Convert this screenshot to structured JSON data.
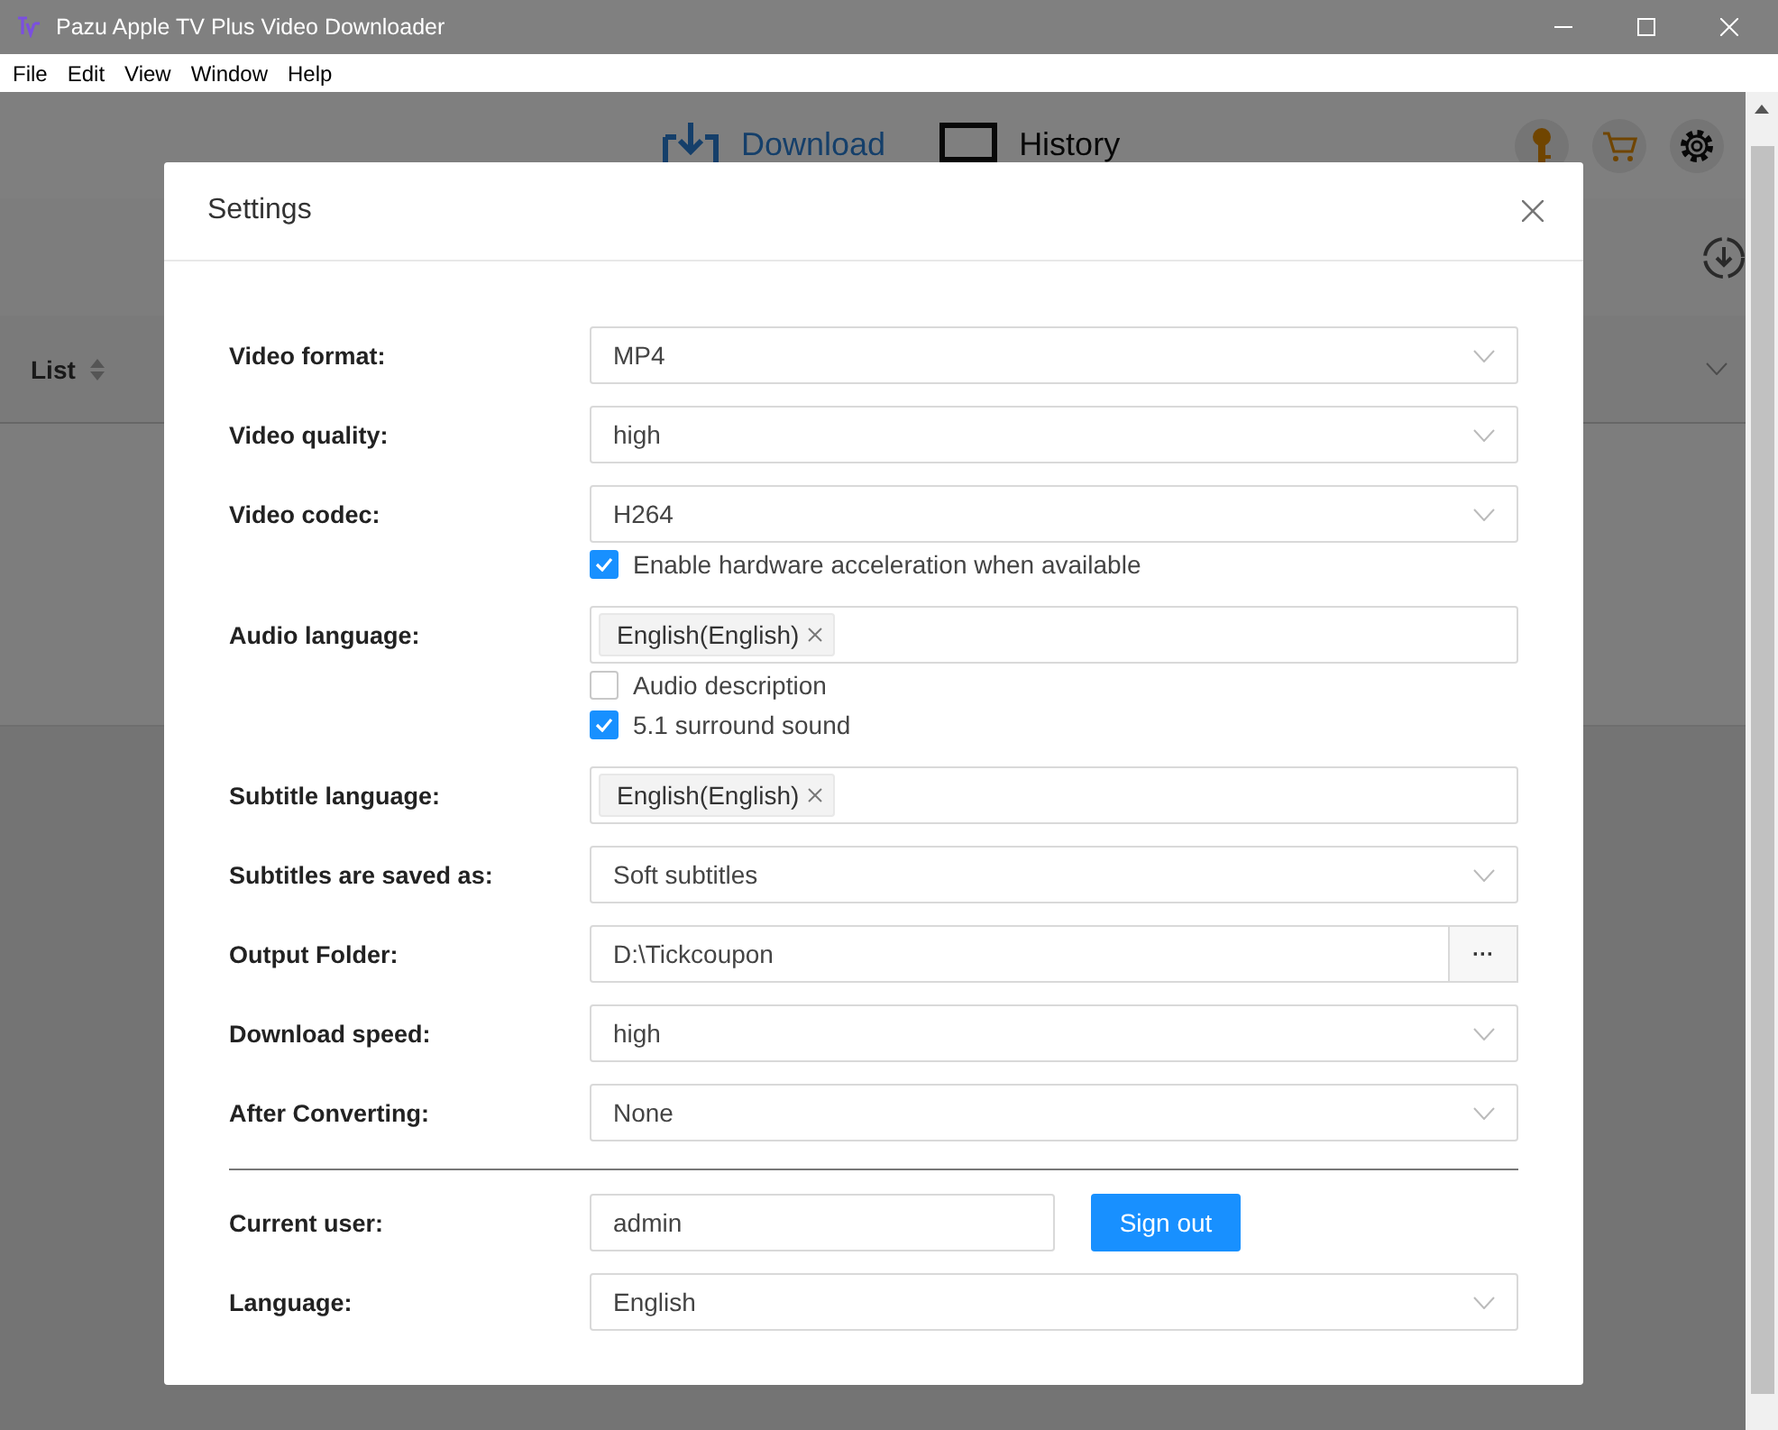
{
  "window": {
    "title": "Pazu Apple TV Plus Video Downloader"
  },
  "menu": [
    "File",
    "Edit",
    "View",
    "Window",
    "Help"
  ],
  "toolbar": {
    "tabs": [
      {
        "label": "Download",
        "selected": true
      },
      {
        "label": "History",
        "selected": false
      }
    ]
  },
  "list_header": {
    "label": "List"
  },
  "dialog": {
    "title": "Settings",
    "fields": [
      {
        "kind": "select",
        "label": "Video format:",
        "value": "MP4"
      },
      {
        "kind": "select",
        "label": "Video quality:",
        "value": "high"
      },
      {
        "kind": "select",
        "label": "Video codec:",
        "value": "H264",
        "options": [
          {
            "label": "Enable hardware acceleration when available",
            "checked": true
          }
        ]
      },
      {
        "kind": "tags",
        "label": "Audio language:",
        "tags": [
          "English(English)"
        ],
        "options": [
          {
            "label": "Audio description",
            "checked": false
          },
          {
            "label": "5.1 surround sound",
            "checked": true
          }
        ]
      },
      {
        "kind": "tags",
        "label": "Subtitle language:",
        "tags": [
          "English(English)"
        ]
      },
      {
        "kind": "select",
        "label": "Subtitles are saved as:",
        "value": "Soft subtitles"
      },
      {
        "kind": "folder",
        "label": "Output Folder:",
        "value": "D:\\Tickcoupon",
        "button": "···"
      },
      {
        "kind": "select",
        "label": "Download speed:",
        "value": "high"
      },
      {
        "kind": "select",
        "label": "After Converting:",
        "value": "None"
      }
    ],
    "account": [
      {
        "kind": "user",
        "label": "Current user:",
        "value": "admin",
        "button": "Sign out"
      },
      {
        "kind": "select",
        "label": "Language:",
        "value": "English"
      }
    ]
  }
}
